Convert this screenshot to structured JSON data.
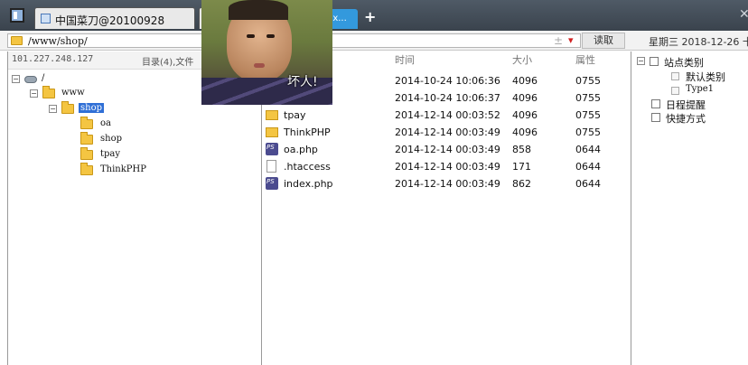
{
  "tabs": [
    {
      "label": "中国菜刀@20100928"
    },
    {
      "label": "dex..."
    }
  ],
  "window": {
    "close_glyph": "✕",
    "add_tab_glyph": "+"
  },
  "toolbar": {
    "path": "/www/shop/",
    "read_label": "读取",
    "date_text": "星期三 2018-12-26 十"
  },
  "left_pane": {
    "ip": "101.227.248.127",
    "dir_summary": "目录(4),文件",
    "tree": [
      {
        "label": "/",
        "depth": 0
      },
      {
        "label": "www",
        "depth": 1
      },
      {
        "label": "shop",
        "depth": 2,
        "selected": true
      },
      {
        "label": "oa",
        "depth": 3
      },
      {
        "label": "shop",
        "depth": 3
      },
      {
        "label": "tpay",
        "depth": 3
      },
      {
        "label": "ThinkPHP",
        "depth": 3
      }
    ]
  },
  "files": {
    "columns": {
      "time": "时间",
      "size": "大小",
      "attr": "属性"
    },
    "rows": [
      {
        "name": "",
        "time": "2014-10-24 10:06:36",
        "size": "4096",
        "attr": "0755",
        "icon": "folder-icon"
      },
      {
        "name": "",
        "time": "2014-10-24 10:06:37",
        "size": "4096",
        "attr": "0755",
        "icon": "folder-icon"
      },
      {
        "name": "tpay",
        "time": "2014-12-14 00:03:52",
        "size": "4096",
        "attr": "0755",
        "icon": "folder-icon"
      },
      {
        "name": "ThinkPHP",
        "time": "2014-12-14 00:03:49",
        "size": "4096",
        "attr": "0755",
        "icon": "folder-icon"
      },
      {
        "name": "oa.php",
        "time": "2014-12-14 00:03:49",
        "size": "858",
        "attr": "0644",
        "icon": "php-file-icon"
      },
      {
        "name": ".htaccess",
        "time": "2014-12-14 00:03:49",
        "size": "171",
        "attr": "0644",
        "icon": "file-icon"
      },
      {
        "name": "index.php",
        "time": "2014-12-14 00:03:49",
        "size": "862",
        "attr": "0644",
        "icon": "php-file-icon"
      }
    ]
  },
  "right_pane": {
    "site_category": "站点类别",
    "default_category": "默认类别",
    "type1": "Type1",
    "reminder": "日程提醒",
    "shortcuts": "快捷方式"
  },
  "meme": {
    "caption": "坏人!"
  }
}
